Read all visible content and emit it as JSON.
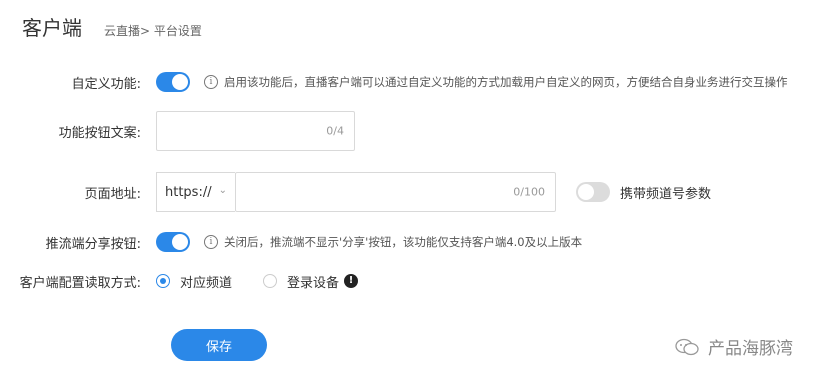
{
  "header": {
    "title": "客户端",
    "breadcrumb": "云直播>  平台设置"
  },
  "custom_feature": {
    "label": "自定义功能:",
    "enabled": true,
    "info": "启用该功能后，直播客户端可以通过自定义功能的方式加载用户自定义的网页，方便结合自身业务进行交互操作"
  },
  "button_text": {
    "label": "功能按钮文案:",
    "value": "",
    "counter": "0/4"
  },
  "page_url": {
    "label": "页面地址:",
    "protocol": "https://",
    "value": "",
    "counter": "0/100",
    "carry_channel_label": "携带频道号参数",
    "carry_channel_enabled": false
  },
  "share_button": {
    "label": "推流端分享按钮:",
    "enabled": true,
    "info": "关闭后，推流端不显示'分享'按钮，该功能仅支持客户端4.0及以上版本"
  },
  "read_mode": {
    "label": "客户端配置读取方式:",
    "options": [
      "对应频道",
      "登录设备"
    ],
    "selected": "对应频道"
  },
  "save_label": "保存",
  "watermark": "产品海豚湾",
  "colors": {
    "accent": "#2b88e8"
  }
}
